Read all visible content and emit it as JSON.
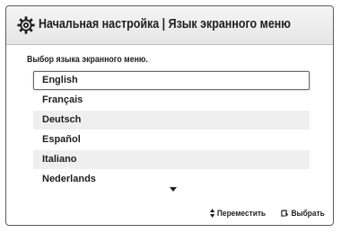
{
  "header": {
    "icon": "gear-icon",
    "title": "Начальная настройка | Язык экранного меню"
  },
  "prompt": "Выбор языка экранного меню.",
  "languages": [
    {
      "label": "English",
      "selected": true
    },
    {
      "label": "Français",
      "selected": false
    },
    {
      "label": "Deutsch",
      "selected": false
    },
    {
      "label": "Español",
      "selected": false
    },
    {
      "label": "Italiano",
      "selected": false
    },
    {
      "label": "Nederlands",
      "selected": false
    }
  ],
  "more_icon": "arrow-down-icon",
  "footer": {
    "move_icon": "up-down-arrows-icon",
    "move_label": "Переместить",
    "select_icon": "enter-icon",
    "select_label": "Выбрать"
  }
}
